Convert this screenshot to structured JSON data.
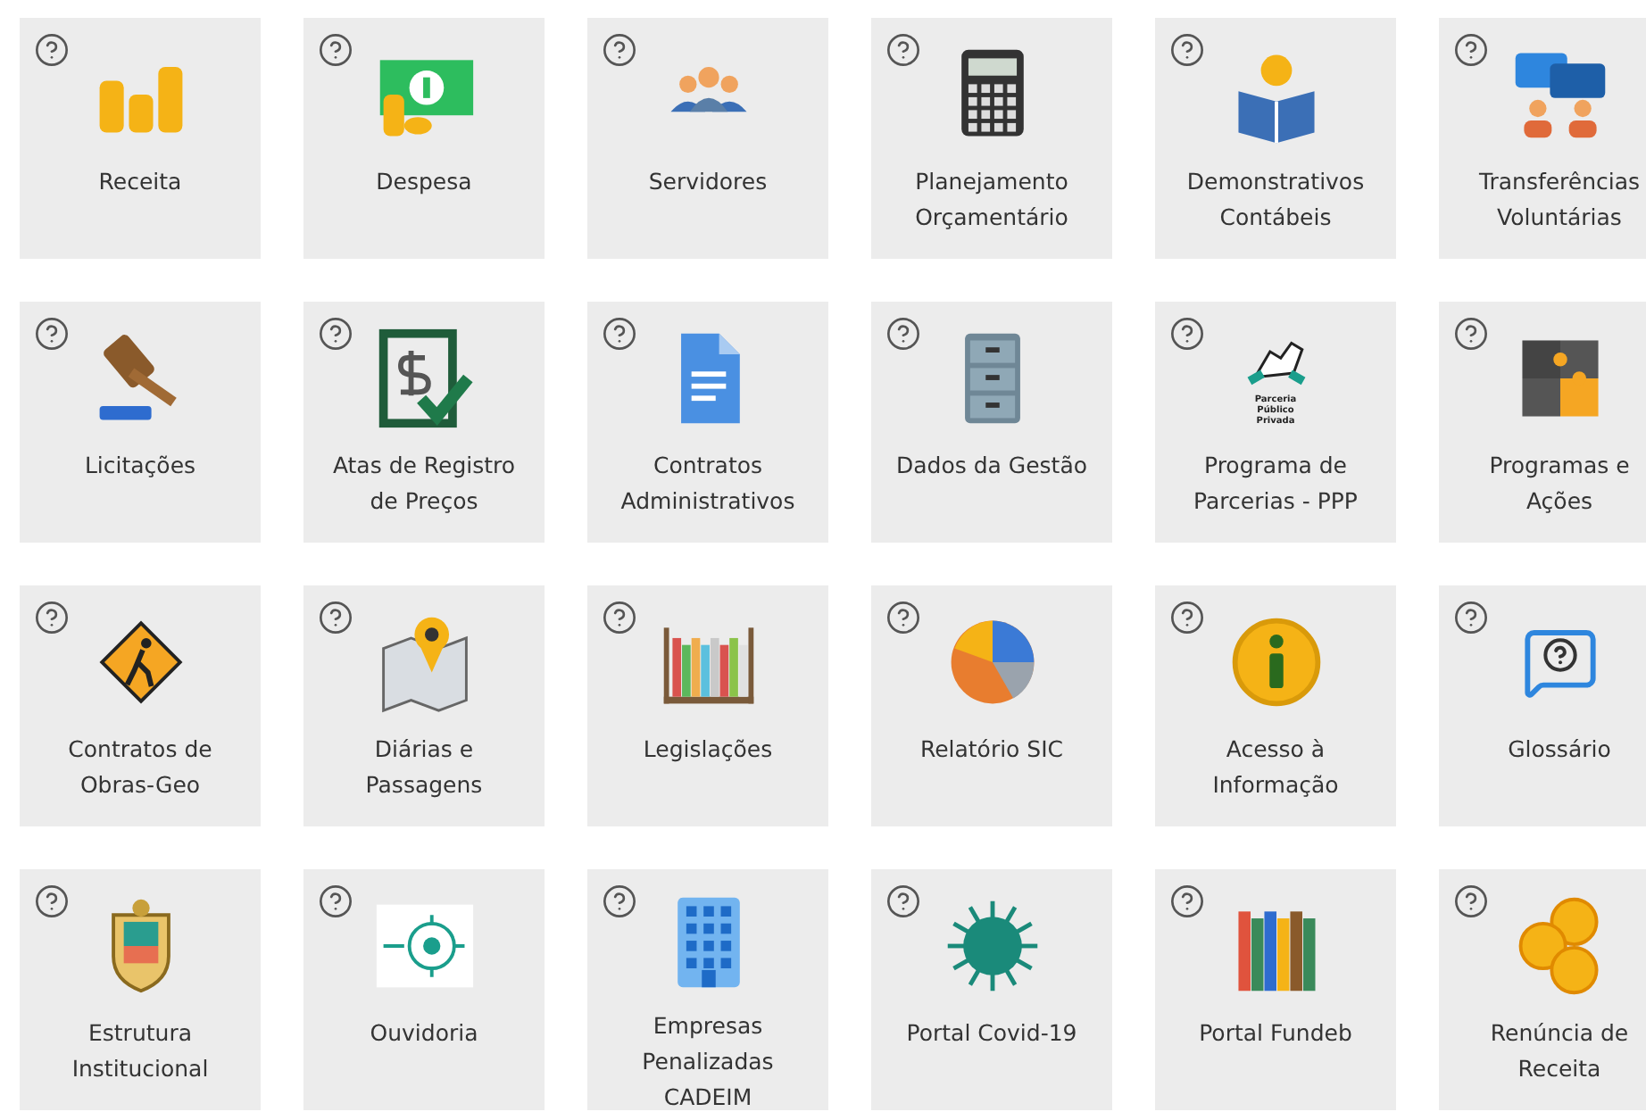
{
  "tiles": [
    {
      "label": "Receita"
    },
    {
      "label": "Despesa"
    },
    {
      "label": "Servidores"
    },
    {
      "label": "Planejamento Orçamentário"
    },
    {
      "label": "Demonstrativos Contábeis"
    },
    {
      "label": "Transferências Voluntárias"
    },
    {
      "label": "Licitações"
    },
    {
      "label": "Atas de Registro de Preços"
    },
    {
      "label": "Contratos Administrativos"
    },
    {
      "label": "Dados da Gestão"
    },
    {
      "label": "Programa de Parcerias - PPP",
      "logo_text": "Parceria Público Privada"
    },
    {
      "label": "Programas e Ações"
    },
    {
      "label": "Contratos de Obras-Geo"
    },
    {
      "label": "Diárias e Passagens"
    },
    {
      "label": "Legislações"
    },
    {
      "label": "Relatório SIC"
    },
    {
      "label": "Acesso à Informação"
    },
    {
      "label": "Glossário"
    },
    {
      "label": "Estrutura Institucional"
    },
    {
      "label": "Ouvidoria"
    },
    {
      "label": "Empresas Penalizadas CADEIM"
    },
    {
      "label": "Portal Covid-19"
    },
    {
      "label": "Portal Fundeb"
    },
    {
      "label": "Renúncia de Receita"
    }
  ]
}
